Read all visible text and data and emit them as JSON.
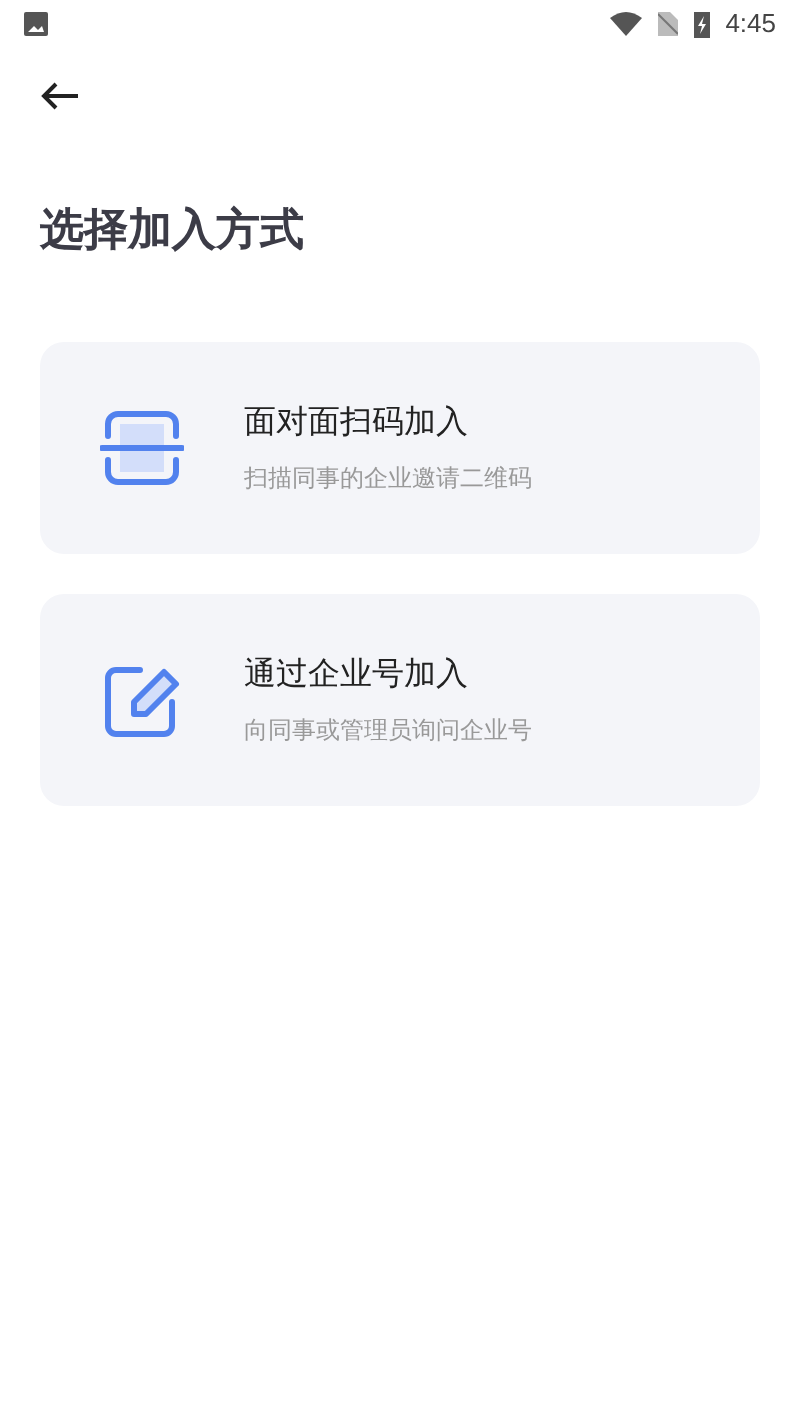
{
  "status_bar": {
    "time": "4:45"
  },
  "title": "选择加入方式",
  "options": [
    {
      "kind": "scan",
      "title": "面对面扫码加入",
      "subtitle": "扫描同事的企业邀请二维码"
    },
    {
      "kind": "edit",
      "title": "通过企业号加入",
      "subtitle": "向同事或管理员询问企业号"
    }
  ]
}
